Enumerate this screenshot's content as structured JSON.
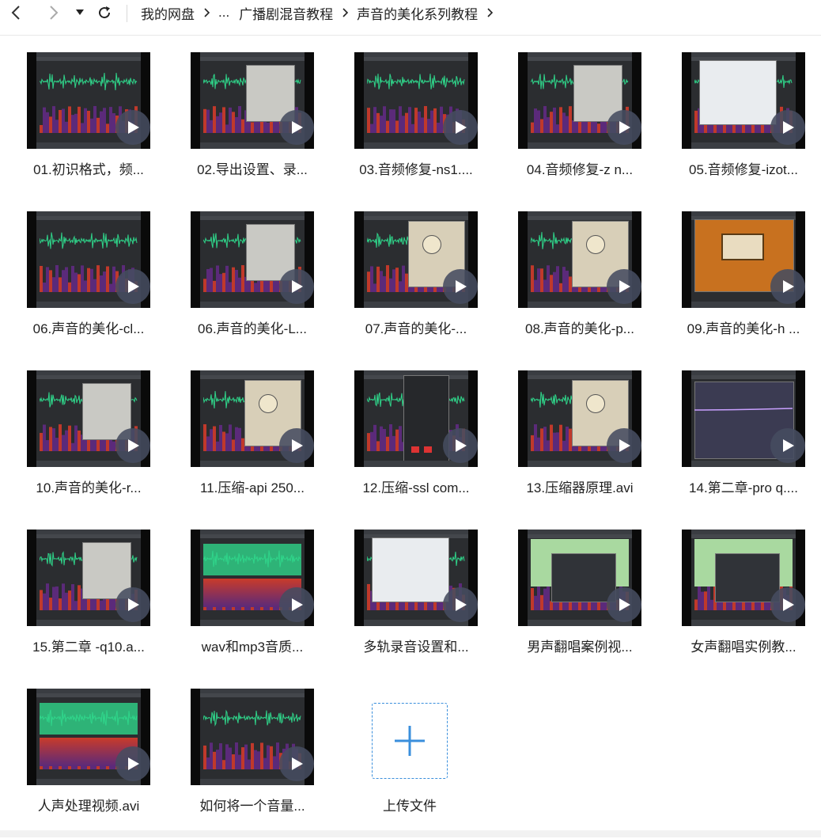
{
  "nav": {
    "back_icon": "chevron-left-icon",
    "forward_icon": "chevron-right-icon",
    "history_icon": "caret-down-icon",
    "refresh_icon": "refresh-icon"
  },
  "breadcrumb": [
    "我的网盘",
    "...",
    "广播剧混音教程",
    "声音的美化系列教程"
  ],
  "files": [
    "01.初识格式，频...",
    "02.导出设置、录...",
    "03.音频修复-ns1....",
    "04.音频修复-z n...",
    "05.音频修复-izot...",
    "06.声音的美化-cl...",
    "06.声音的美化-L...",
    "07.声音的美化-...",
    "08.声音的美化-p...",
    "09.声音的美化-h ...",
    "10.声音的美化-r...",
    "11.压缩-api 250...",
    "12.压缩-ssl com...",
    "13.压缩器原理.avi",
    "14.第二章-pro q....",
    "15.第二章 -q10.a...",
    "wav和mp3音质...",
    "多轨录音设置和...",
    "男声翻唱案例视...",
    "女声翻唱实例教...",
    "人声处理视频.avi",
    "如何将一个音量..."
  ],
  "upload": {
    "label": "上传文件",
    "icon": "plus-icon"
  },
  "colors": {
    "accent": "#3a8fdc",
    "play_button": "#464c60",
    "waveform": "#2fd58a"
  }
}
